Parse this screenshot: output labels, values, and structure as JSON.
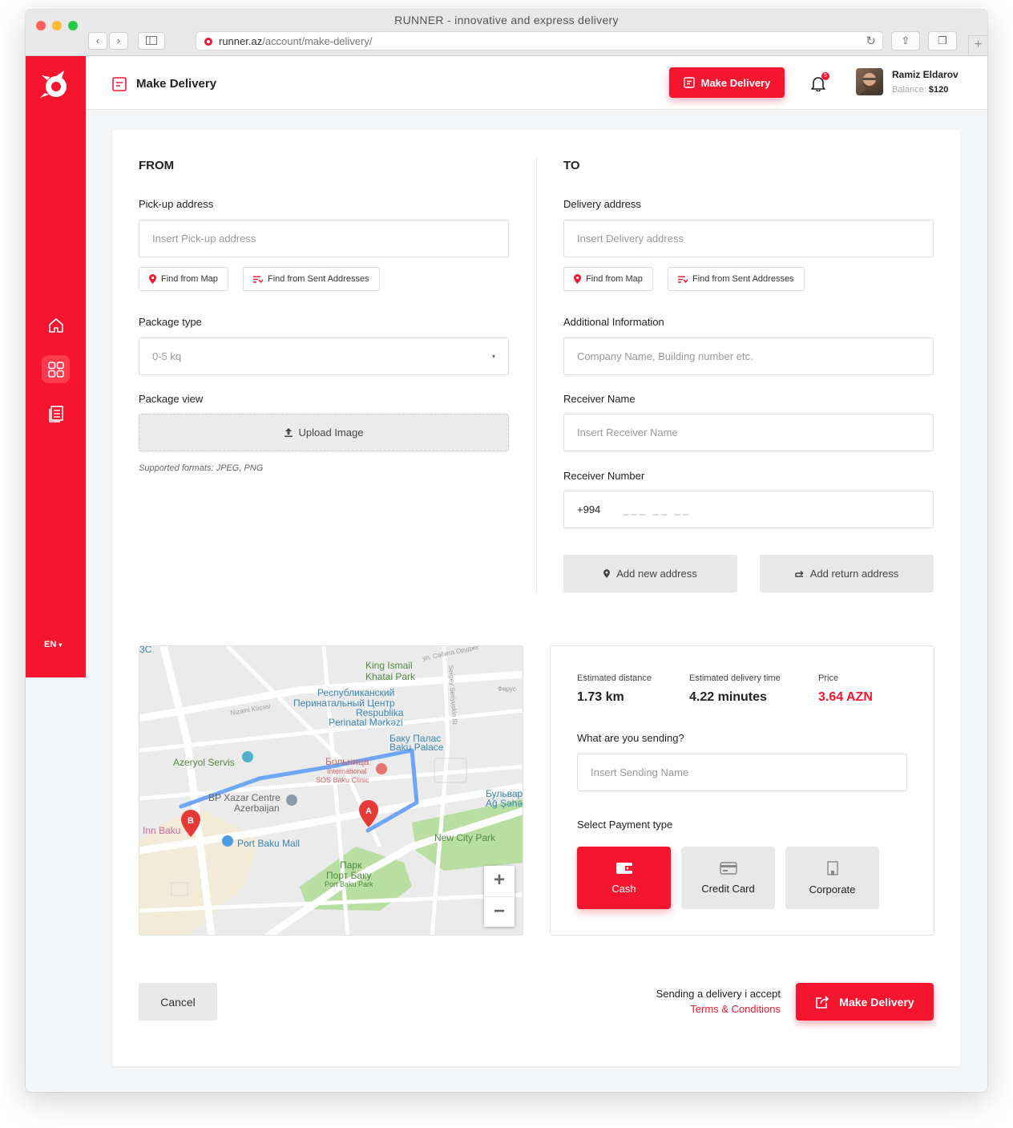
{
  "window": {
    "title": "RUNNER - innovative and express delivery",
    "url_host": "runner.az",
    "url_path": "/account/make-delivery/"
  },
  "sidebar": {
    "language": "EN"
  },
  "header": {
    "title": "Make Delivery",
    "cta_label": "Make Delivery",
    "notification_count": "5",
    "user_name": "Ramiz Eldarov",
    "balance_label": "Balance:",
    "balance_value": "$120"
  },
  "from": {
    "heading": "FROM",
    "pickup_label": "Pick-up address",
    "pickup_placeholder": "Insert Pick-up address",
    "find_map": "Find from Map",
    "find_sent": "Find from Sent Addresses",
    "package_type_label": "Package type",
    "package_type_value": "0-5 kq",
    "package_view_label": "Package view",
    "upload_label": "Upload Image",
    "formats_hint": "Supported formats: JPEG, PNG"
  },
  "to": {
    "heading": "TO",
    "delivery_label": "Delivery address",
    "delivery_placeholder": "Insert Delivery address",
    "find_map": "Find from Map",
    "find_sent": "Find from Sent Addresses",
    "additional_label": "Additional Information",
    "additional_placeholder": "Company Name, Building number etc.",
    "receiver_name_label": "Receiver Name",
    "receiver_name_placeholder": "Insert Receiver Name",
    "receiver_number_label": "Receiver Number",
    "phone_prefix": "+994",
    "phone_mask": "___ __ __",
    "add_new": "Add new address",
    "add_return": "Add return  address"
  },
  "map": {
    "labels": {
      "king_ismail": "King Ismail",
      "khatai_park": "Khatai Park",
      "perinatal_ru1": "Республиканский",
      "perinatal_ru2": "Перинатальный Центр",
      "perinatal_ru3": "Respublika",
      "perinatal_az": "Perinatal Mərkəzi",
      "baku_palace_ru": "Баку Палас",
      "baku_palace": "Baku Palace",
      "azeryol": "Azeryol Servis",
      "hospital_ru": "Больница",
      "hospital_int": "International",
      "sos": "SOS Baku Clinic",
      "bp_xazar": "BP Xazar Centre",
      "azerbaijan": "Azerbaijan",
      "inn_baku": "Inn Baku",
      "port_baku_mall": "Port Baku Mall",
      "new_city_park": "New City Park",
      "park_ru": "Парк",
      "port_baku_ru": "Порт Баку",
      "port_baku_park": "Port Baku Park",
      "bulvar_ru": "Бульвар",
      "ag_sehar": "Ağ Şəhər",
      "nizami": "Nizami Küçəsi",
      "sabita": "ул. Сабита Орудже",
      "sergey": "Sergey Seriyuskin St",
      "ferus": "Фөрус",
      "corner": "3C",
      "pin_a": "A",
      "pin_b": "B"
    }
  },
  "estimate": {
    "distance_label": "Estimated distance",
    "distance_value": "1.73 km",
    "time_label": "Estimated delivery time",
    "time_value": "4.22 minutes",
    "price_label": "Price",
    "price_value": "3.64 AZN",
    "sending_label": "What are you sending?",
    "sending_placeholder": "Insert Sending Name",
    "payment_label": "Select Payment type",
    "payment_options": [
      "Cash",
      "Credit Card",
      "Corporate"
    ]
  },
  "footer": {
    "cancel": "Cancel",
    "accept_text": "Sending a delivery i accept",
    "terms": "Terms & Conditions",
    "submit": "Make Delivery"
  },
  "colors": {
    "brand": "#f5152f",
    "map_route": "#6ea5f5"
  }
}
